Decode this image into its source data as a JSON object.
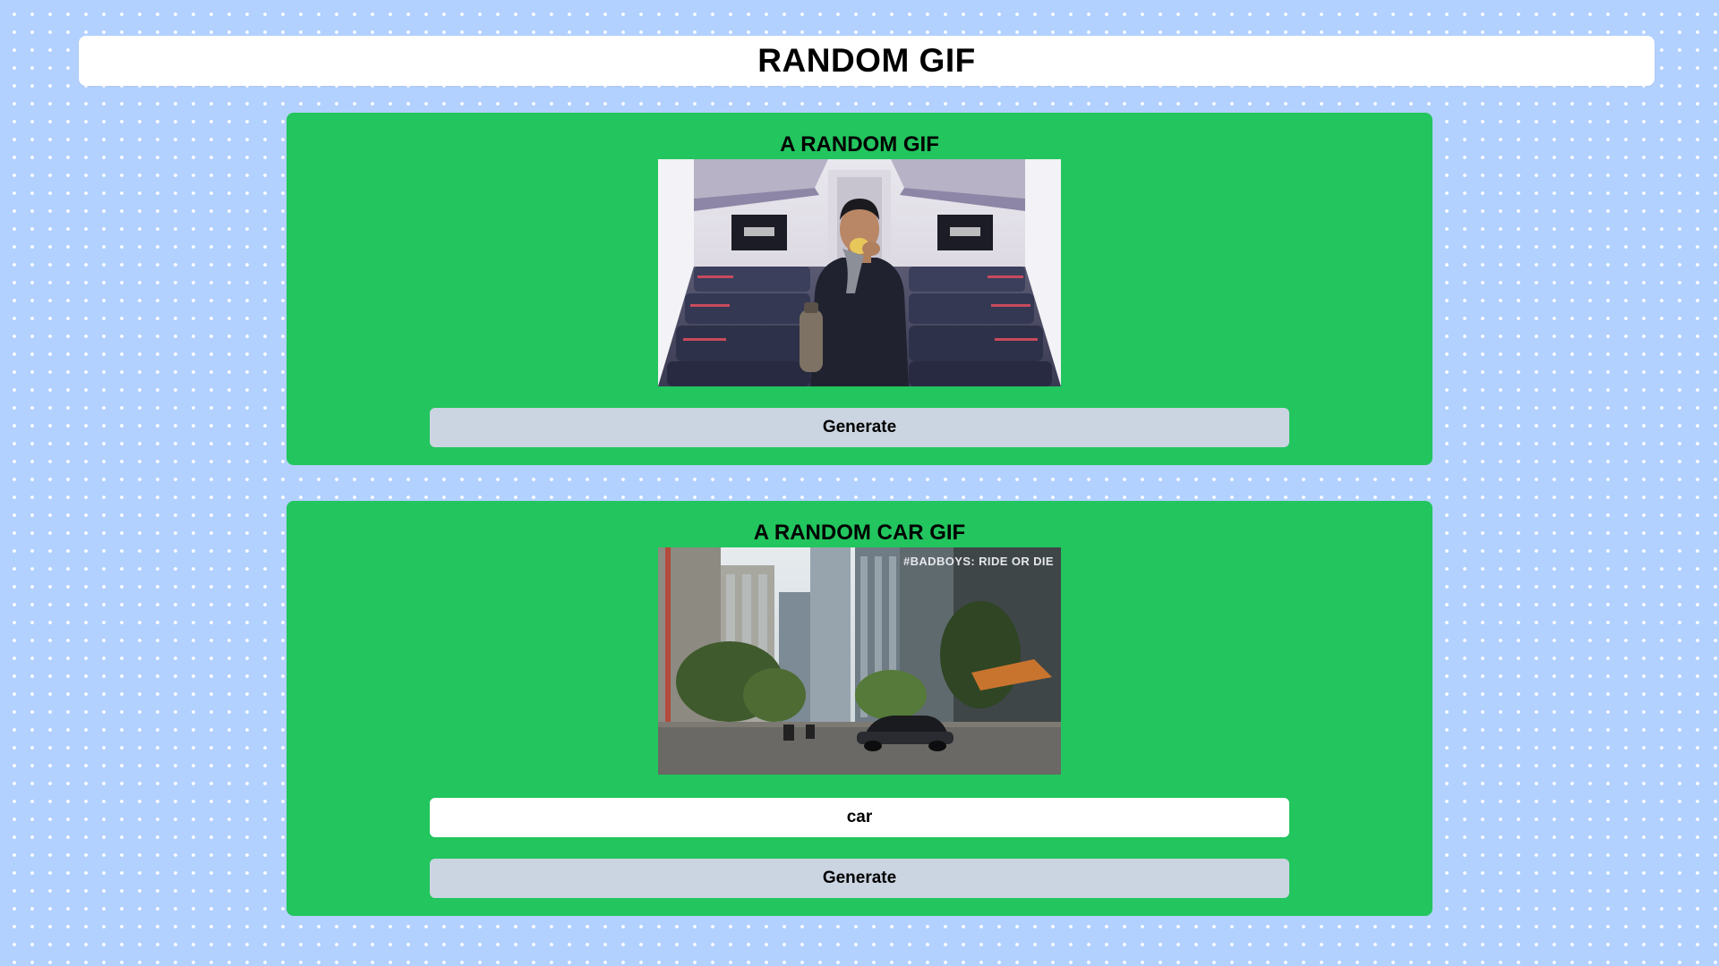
{
  "header": {
    "title": "RANDOM GIF"
  },
  "random_card": {
    "title": "A RANDOM GIF",
    "image_alt": "airplane cabin gif",
    "generate_label": "Generate"
  },
  "tag_card": {
    "title": "A RANDOM CAR GIF",
    "image_overlay_text": "#BADBOYS: RIDE OR DIE",
    "search_value": "car",
    "generate_label": "Generate"
  },
  "colors": {
    "page_background": "#b3d1ff",
    "card_background": "#22c55e",
    "button_background": "#cbd5e1",
    "header_background": "#ffffff"
  }
}
